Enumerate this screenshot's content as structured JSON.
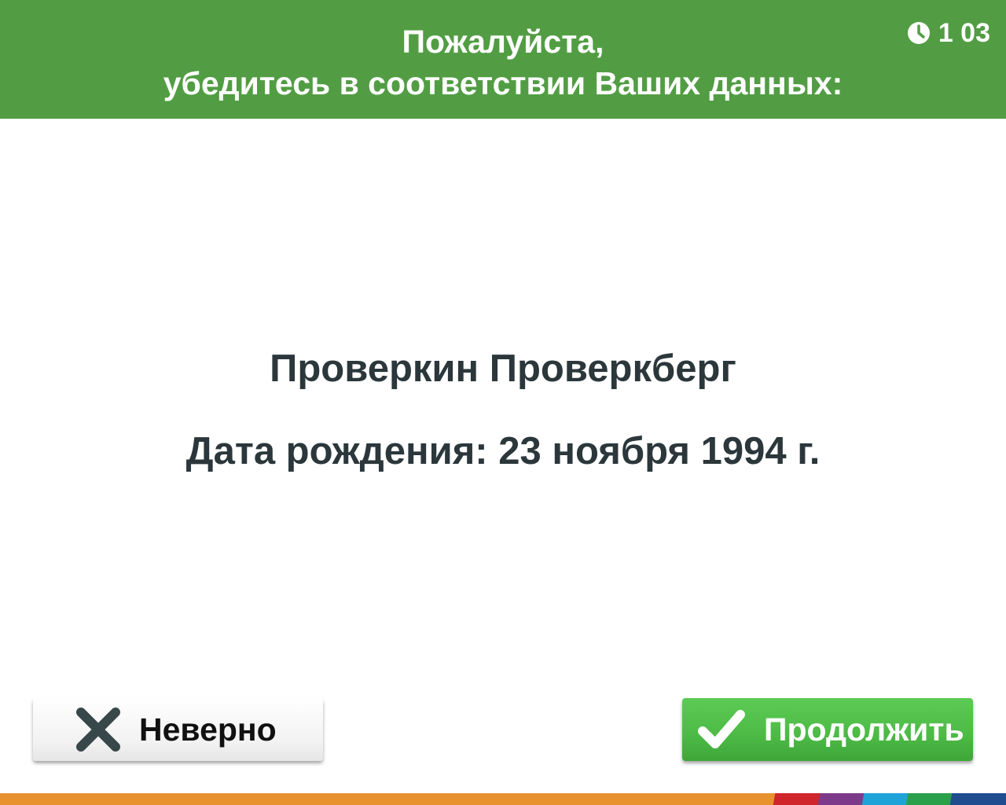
{
  "header": {
    "title_line1": "Пожалуйста,",
    "title_line2": "убедитесь в соответствии Ваших данных:",
    "timer": "1 03",
    "timer_icon": "clock-icon",
    "background_color": "#529d44"
  },
  "person": {
    "name": "Проверкин Проверкберг",
    "birth_date": "Дата рождения: 23 ноября 1994 г."
  },
  "buttons": {
    "wrong_label": "Неверно",
    "wrong_icon": "close-icon",
    "continue_label": "Продолжить",
    "continue_icon": "check-icon",
    "continue_color": "#4cba45"
  },
  "footer_bar": {
    "colors": [
      "#e8912f",
      "#d0252b",
      "#7e3a8a",
      "#1ea3d9",
      "#2aa04a",
      "#1f4c8f"
    ]
  }
}
